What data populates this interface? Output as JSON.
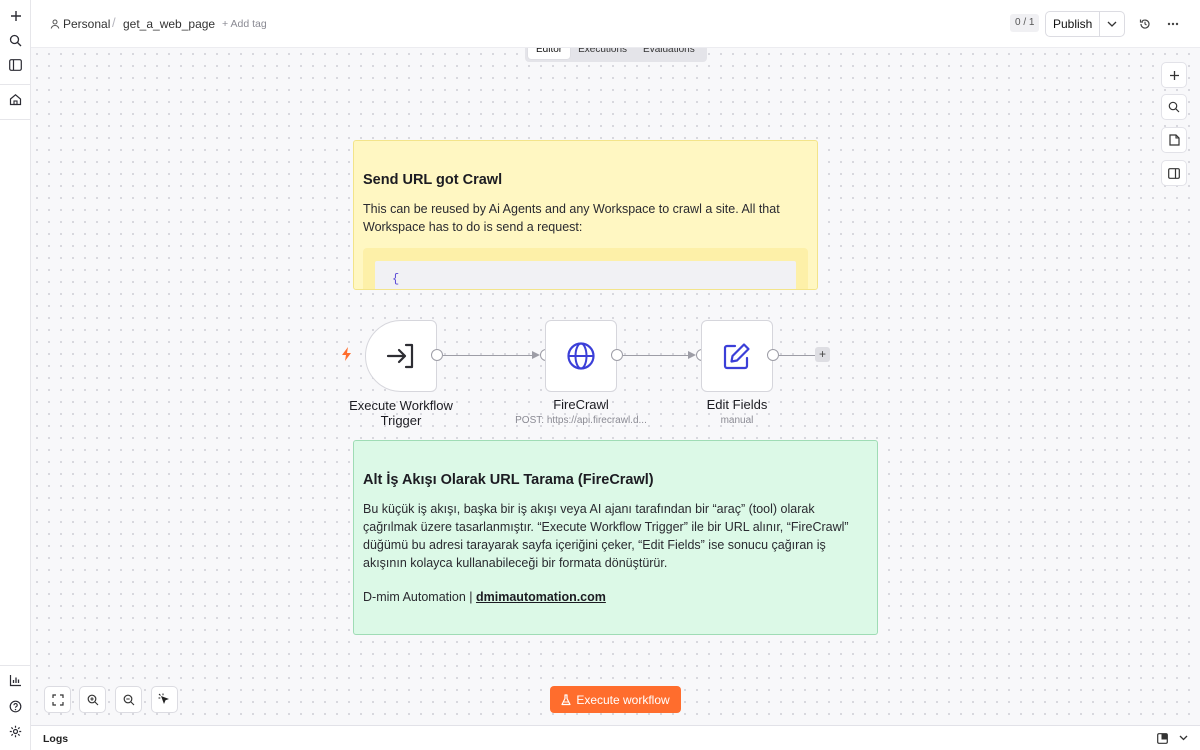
{
  "breadcrumb": {
    "project": "Personal",
    "separator": "/",
    "workflow_name": "get_a_web_page",
    "add_tag": "+ Add tag"
  },
  "header": {
    "version_counter": "0 / 1",
    "publish_label": "Publish"
  },
  "tabs": [
    {
      "label": "Editor",
      "active": true
    },
    {
      "label": "Executions",
      "active": false
    },
    {
      "label": "Evaluations",
      "active": false
    }
  ],
  "sticky_yellow": {
    "title": "Send URL got Crawl",
    "body": "This can be reused by Ai Agents and any Workspace to crawl a site. All that Workspace has to do is send a request:",
    "code": "{"
  },
  "sticky_green": {
    "title": "Alt İş Akışı Olarak URL Tarama (FireCrawl)",
    "body": "Bu küçük iş akışı, başka bir iş akışı veya AI ajanı tarafından bir “araç” (tool) olarak çağrılmak üzere tasarlanmıştır. “Execute Workflow Trigger” ile bir URL alınır, “FireCrawl” düğümü bu adresi tarayarak sayfa içeriğini çeker, “Edit Fields” ise sonucu çağıran iş akışının kolayca kullanabileceği bir formata dönüştürür.",
    "signature_prefix": "D-mim Automation | ",
    "signature_link": "dmimautomation.com"
  },
  "nodes": [
    {
      "title": "Execute Workflow Trigger",
      "subtitle": "",
      "icon": "sign-in-icon"
    },
    {
      "title": "FireCrawl",
      "subtitle": "POST: https://api.firecrawl.d...",
      "icon": "globe-icon"
    },
    {
      "title": "Edit Fields",
      "subtitle": "manual",
      "icon": "pen-square-icon"
    }
  ],
  "execute_button": "Execute workflow",
  "logs_label": "Logs",
  "colors": {
    "accent_orange": "#ff6d2d",
    "node_icon_blue": "#3b3fd8",
    "sticky_yellow": "#fff7c2",
    "sticky_green": "#dcf9e7"
  }
}
